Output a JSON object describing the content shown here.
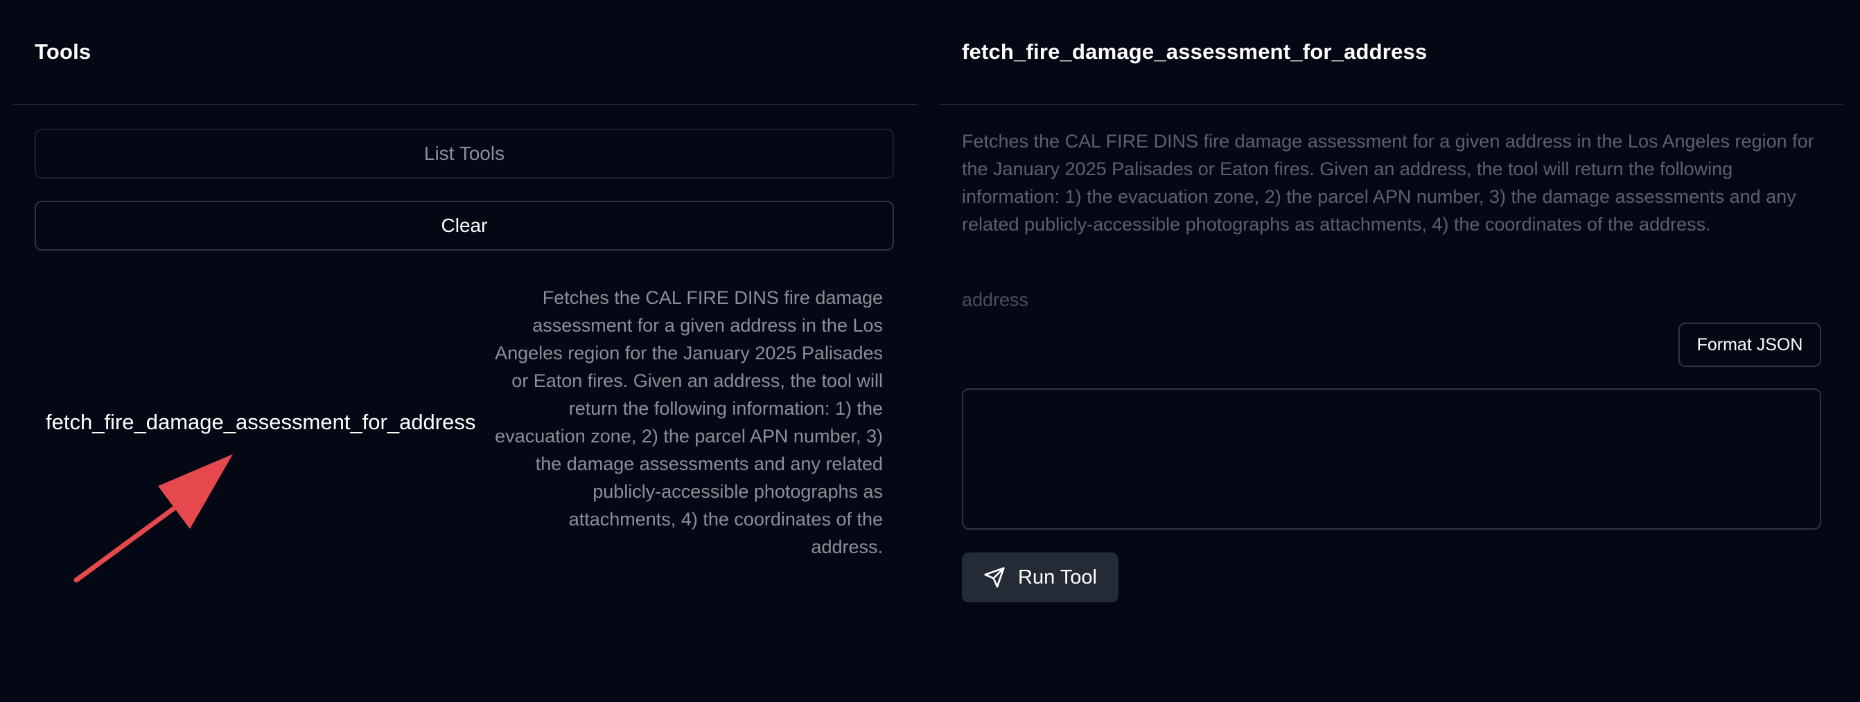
{
  "left": {
    "title": "Tools",
    "list_tools_label": "List Tools",
    "clear_label": "Clear",
    "tool": {
      "name": "fetch_fire_damage_assessment_for_address",
      "description": "Fetches the CAL FIRE DINS fire damage assessment for a given address in the Los Angeles region for the January 2025 Palisades or Eaton fires. Given an address, the tool will return the following information: 1) the evacuation zone, 2) the parcel APN number, 3) the damage assessments and any related publicly-accessible photographs as attachments, 4) the coordinates of the address."
    }
  },
  "right": {
    "title": "fetch_fire_damage_assessment_for_address",
    "description": "Fetches the CAL FIRE DINS fire damage assessment for a given address in the Los Angeles region for the January 2025 Palisades or Eaton fires. Given an address, the tool will return the following information: 1) the evacuation zone, 2) the parcel APN number, 3) the damage assessments and any related publicly-accessible photographs as attachments, 4) the coordinates of the address.",
    "field_label": "address",
    "format_json_label": "Format JSON",
    "json_value": "",
    "run_label": "Run Tool"
  },
  "icons": {
    "run": "send-icon",
    "annotation": "arrow-annotation-icon"
  },
  "colors": {
    "background": "#040814",
    "arrow": "#e5484d",
    "run_button": "#242a36"
  }
}
